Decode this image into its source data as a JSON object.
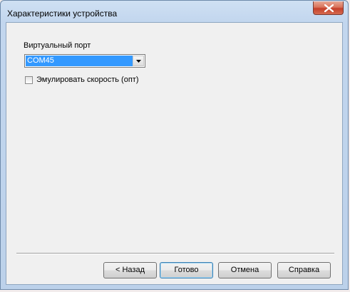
{
  "window": {
    "title": "Характеристики устройства",
    "close_icon": "close-icon"
  },
  "form": {
    "port_label": "Виртуальный порт",
    "port_value": "COM45",
    "emulate_label": "Эмулировать скорость (опт)",
    "emulate_checked": false
  },
  "buttons": {
    "back": "< Назад",
    "finish": "Готово",
    "cancel": "Отмена",
    "help": "Справка"
  },
  "colors": {
    "selection": "#3399ff",
    "close_button": "#c5402a",
    "window_frame": "#bcd1ea",
    "client_background": "#f0f0f0"
  }
}
